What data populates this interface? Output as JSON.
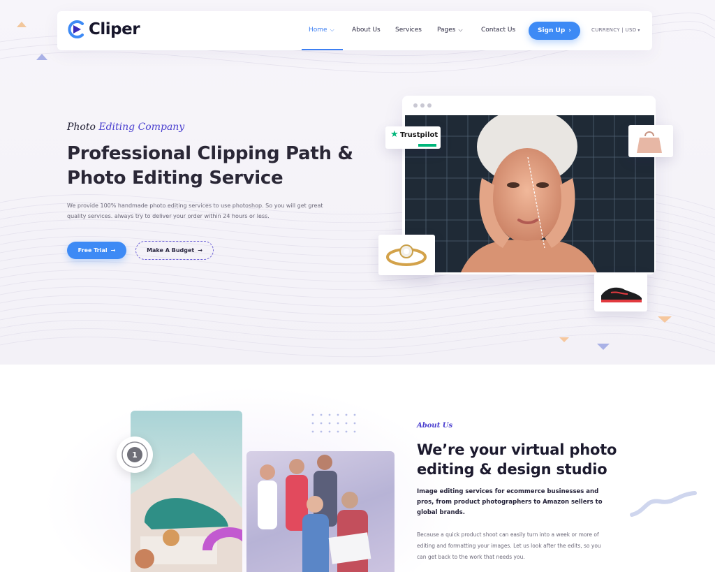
{
  "brand": {
    "name": "Cliper",
    "accent": "#3d8af5",
    "purple": "#4a3fcf"
  },
  "nav": {
    "items": [
      {
        "label": "Home",
        "has_dropdown": true,
        "active": true
      },
      {
        "label": "About Us",
        "has_dropdown": false
      },
      {
        "label": "Services",
        "has_dropdown": false
      },
      {
        "label": "Pages",
        "has_dropdown": true
      },
      {
        "label": "Contact Us",
        "has_dropdown": false
      }
    ],
    "signup_label": "Sign Up",
    "currency_label": "CURRENCY | USD"
  },
  "hero": {
    "eyebrow_prefix": "Photo",
    "eyebrow_accent": "Editing Company",
    "title": "Professional Clipping Path & Photo Editing Service",
    "description": "We provide 100% handmade photo editing services to use photoshop. So you will get great quality services. always try to deliver your order within 24 hours or less.",
    "primary_button": "Free Trial",
    "secondary_button": "Make A Budget",
    "trustpilot_label": "Trustpilot"
  },
  "about": {
    "eyebrow": "About Us",
    "title": "We’re your virtual photo editing & design studio",
    "lead": "Image editing services for ecommerce businesses and pros, from product photographers to Amazon sellers to global brands.",
    "body": "Because a quick product shoot can easily turn into a week or more of editing and formatting your images. Let us look after the edits, so you can get back to the work that needs you.",
    "badge_number": "1"
  }
}
